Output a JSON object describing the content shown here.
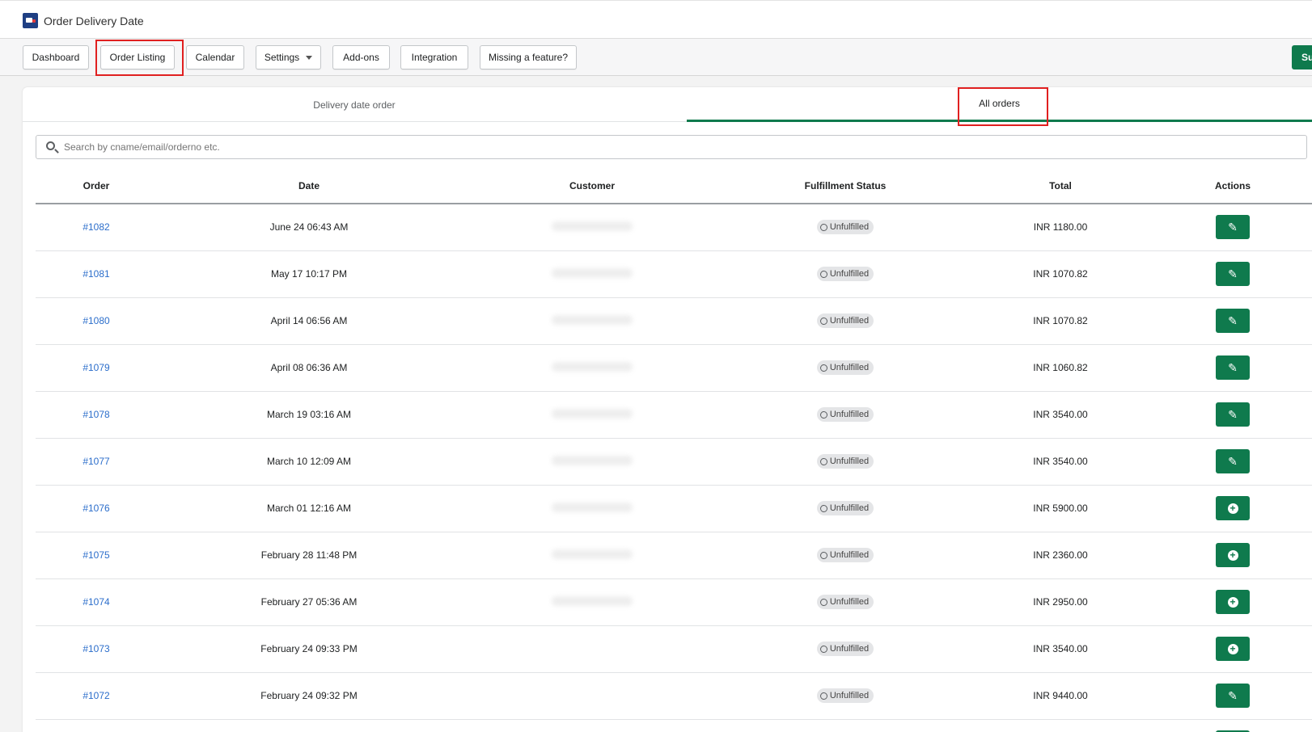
{
  "app": {
    "title": "Order Delivery Date"
  },
  "nav": {
    "dashboard": "Dashboard",
    "order_listing": "Order Listing",
    "calendar": "Calendar",
    "settings": "Settings",
    "addons": "Add-ons",
    "integration": "Integration",
    "missing_feature": "Missing a feature?",
    "green_button": "Su"
  },
  "tabs": {
    "delivery_date_order": "Delivery date order",
    "all_orders": "All orders"
  },
  "search": {
    "placeholder": "Search by cname/email/orderno etc."
  },
  "table": {
    "headers": {
      "order": "Order",
      "date": "Date",
      "customer": "Customer",
      "status": "Fulfillment Status",
      "total": "Total",
      "actions": "Actions"
    },
    "rows": [
      {
        "order": "#1082",
        "date": "June 24 06:43 AM",
        "status": "Unfulfilled",
        "total": "INR 1180.00",
        "action": "edit"
      },
      {
        "order": "#1081",
        "date": "May 17 10:17 PM",
        "status": "Unfulfilled",
        "total": "INR 1070.82",
        "action": "edit"
      },
      {
        "order": "#1080",
        "date": "April 14 06:56 AM",
        "status": "Unfulfilled",
        "total": "INR 1070.82",
        "action": "edit"
      },
      {
        "order": "#1079",
        "date": "April 08 06:36 AM",
        "status": "Unfulfilled",
        "total": "INR 1060.82",
        "action": "edit"
      },
      {
        "order": "#1078",
        "date": "March 19 03:16 AM",
        "status": "Unfulfilled",
        "total": "INR 3540.00",
        "action": "edit"
      },
      {
        "order": "#1077",
        "date": "March 10 12:09 AM",
        "status": "Unfulfilled",
        "total": "INR 3540.00",
        "action": "edit"
      },
      {
        "order": "#1076",
        "date": "March 01 12:16 AM",
        "status": "Unfulfilled",
        "total": "INR 5900.00",
        "action": "add"
      },
      {
        "order": "#1075",
        "date": "February 28 11:48 PM",
        "status": "Unfulfilled",
        "total": "INR 2360.00",
        "action": "add"
      },
      {
        "order": "#1074",
        "date": "February 27 05:36 AM",
        "status": "Unfulfilled",
        "total": "INR 2950.00",
        "action": "add"
      },
      {
        "order": "#1073",
        "date": "February 24 09:33 PM",
        "status": "Unfulfilled",
        "total": "INR 3540.00",
        "action": "add"
      },
      {
        "order": "#1072",
        "date": "February 24 09:32 PM",
        "status": "Unfulfilled",
        "total": "INR 9440.00",
        "action": "edit"
      },
      {
        "order": "",
        "date": "",
        "status": "",
        "total": "",
        "action": "edit"
      }
    ]
  },
  "colors": {
    "accent": "#0f7a4d",
    "link": "#2c6ecb",
    "highlight": "#e02020"
  }
}
